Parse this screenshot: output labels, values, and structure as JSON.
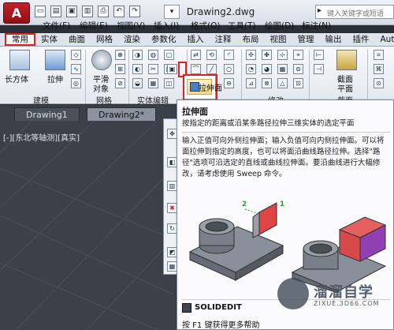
{
  "window": {
    "app_button": "A",
    "doc_title": "Drawing2.dwg",
    "search_placeholder": "键入关键字或短语",
    "quick_access": [
      "new-file-icon",
      "open-file-icon",
      "save-icon",
      "saveas-icon",
      "print-icon",
      "undo-icon",
      "redo-icon"
    ]
  },
  "menubar": [
    "文件(F)",
    "编辑(E)",
    "视图(V)",
    "插入(I)",
    "格式(O)",
    "工具(T)",
    "绘图(D)",
    "标注(N)"
  ],
  "ribbon_tabs": [
    "常用",
    "实体",
    "曲面",
    "网格",
    "渲染",
    "参数化",
    "插入",
    "注释",
    "布局",
    "视图",
    "管理",
    "输出",
    "插件",
    "Autoc"
  ],
  "active_tab": "常用",
  "ribbon": {
    "big_buttons": [
      "长方体",
      "拉伸",
      "平滑",
      "对象",
      "截面",
      "平面"
    ],
    "panels": [
      "建模",
      "网格",
      "实体编辑",
      "修改",
      "截面"
    ]
  },
  "doc_tabs": [
    "Drawing1",
    "Drawing2*"
  ],
  "view_label": "[-][东北等轴测][真实]",
  "flyout": {
    "selected_label": "拉伸面"
  },
  "tooltip": {
    "title": "拉伸面",
    "summary": "按指定的距离或沿某条路径拉伸三维实体的选定平面",
    "description": "输入正值可向外侧拉伸面；输入负值可向内侧拉伸面。可以将面拉伸到指定的高度，也可以将面沿曲线路径拉伸。选择\"路径\"选项可沿选定的直线或曲线拉伸面。要沿曲线进行大幅修改，请考虑使用 Sweep 命令。",
    "markers": [
      "2",
      "1"
    ],
    "command": "SOLIDEDIT",
    "help": "按 F1 键获得更多帮助"
  },
  "watermark": {
    "text": "溜溜自学",
    "sub": "ZIXUE.3D66.COM"
  },
  "colors": {
    "highlight": "#e12020",
    "canvas": "#3b4049",
    "face_red": "#e04545",
    "face_purple": "#9040b0",
    "solid_gray": "#777d87"
  }
}
